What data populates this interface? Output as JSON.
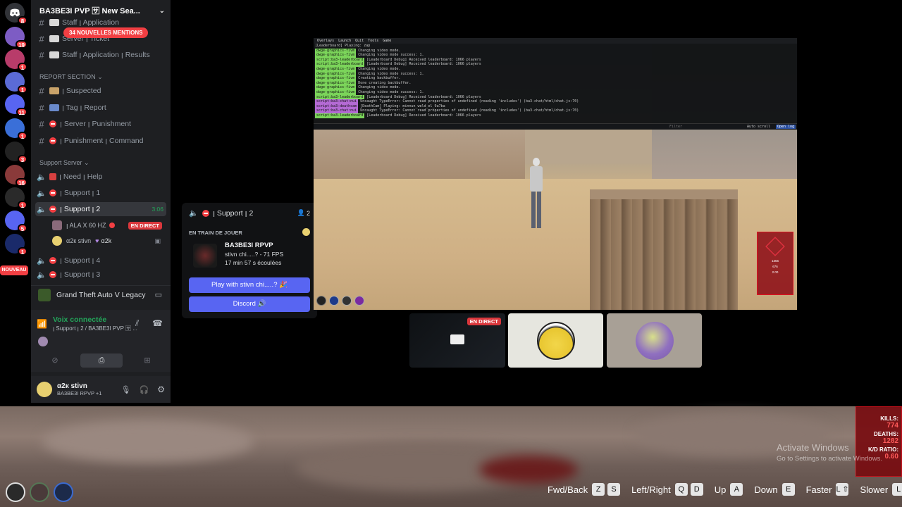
{
  "server": {
    "name": "BA3BE3I PVP 🈂 New Sea...",
    "mentions_badge": "34 NOUVELLES MENTIONS"
  },
  "rail": {
    "badges": [
      "8",
      "19",
      "1",
      "1",
      "11",
      "1",
      "3",
      "16",
      "1",
      "5",
      "1"
    ],
    "new_label": "NOUVEAU"
  },
  "channels": {
    "top": [
      {
        "label": "Staff ꞁ Application"
      },
      {
        "label": "Server ꞁ Ticket"
      },
      {
        "label": "Staff ꞁ Application ꞁ Results"
      }
    ],
    "report_category": "REPORT SECTION",
    "report": [
      {
        "label": "ꞁ Suspected"
      },
      {
        "label": "ꞁ Tag ꞁ Report"
      },
      {
        "label": "ꞁ Server ꞁ Punishment"
      },
      {
        "label": "ꞁ Punishment ꞁ Command"
      }
    ],
    "support_category": "Support Server",
    "support": [
      {
        "label": "ꞁ Need ꞁ Help"
      },
      {
        "label": "ꞁ Support ꞁ 1"
      },
      {
        "label": "ꞁ Support ꞁ 2",
        "time": "3:06"
      },
      {
        "label": "ꞁ Support ꞁ 4"
      },
      {
        "label": "ꞁ Support ꞁ 3"
      }
    ],
    "voice_users": [
      {
        "name": "ꞁ ALA X 60 HZ",
        "badge": "EN DIRECT"
      },
      {
        "name": "α2к stivn",
        "tag": "α2k"
      }
    ]
  },
  "game_activity": {
    "label": "Grand Theft Auto V Legacy"
  },
  "voice": {
    "status": "Voix connectée",
    "channel": "ꞁ Support ꞁ 2 / BA3BE3I PVP 🈂 ..."
  },
  "user": {
    "name": "α2к stivn",
    "status": "BA3BE3I RPVP +1"
  },
  "card": {
    "channel": "ꞁ Support ꞁ 2",
    "count": "2",
    "heading": "EN TRAIN DE JOUER",
    "game": "BA3BE3I RPVP",
    "detail": "stivn chi.....? - 71 FPS",
    "elapsed": "17 min 57 s écoulées",
    "play_button": "Play with stivn chi.....? 🎉",
    "discord_button": "Discord 🔊"
  },
  "console": {
    "menu": [
      "Overlays",
      "Launch",
      "Quit",
      "Tools",
      "Game"
    ],
    "lines": [
      {
        "tag": "",
        "text": "  [Leaderboard] Playing:   zap"
      },
      {
        "tag": "dwge-graphics-fivm",
        "type": "g",
        "text": "Changing video mode."
      },
      {
        "tag": "dwge-graphics-fivm",
        "type": "g",
        "text": "Changing video mode success: 1."
      },
      {
        "tag": "script:ba3-leaderboard",
        "type": "g",
        "text": "[Leaderboard Debug] Received leaderboard: 1066 players"
      },
      {
        "tag": "script:ba3-leaderboard",
        "type": "g",
        "text": "[Leaderboard Debug] Received leaderboard: 1066 players"
      },
      {
        "tag": "dwge-graphics-fivm",
        "type": "g",
        "text": "Changing video mode."
      },
      {
        "tag": "dwge-graphics-fivm",
        "type": "g",
        "text": "Changing video mode success: 1."
      },
      {
        "tag": "dwge-graphics-fivm",
        "type": "g",
        "text": "Creating backbuffer."
      },
      {
        "tag": "dwge-graphics-fivm",
        "type": "g",
        "text": "Done creating backbuffer."
      },
      {
        "tag": "dwge-graphics-fivm",
        "type": "g",
        "text": "Changing video mode."
      },
      {
        "tag": "dwge-graphics-fivm",
        "type": "g",
        "text": "Changing video mode success: 1."
      },
      {
        "tag": "script:ba3-leaderboard",
        "type": "g",
        "text": "[Leaderboard Debug] Received leaderboard: 1066 players"
      },
      {
        "tag": "script:ba3-chat:nui",
        "type": "p",
        "text": "Uncaught TypeError: Cannot read properties of undefined (reading 'includes') (ba3-chat/html/chat.js:70)"
      },
      {
        "tag": "script:ba3-deathcam",
        "type": "p",
        "text": "[DeathCam] Playing:   minnun_weld_el_9a7ba"
      },
      {
        "tag": "script:ba3-chat:nui",
        "type": "p",
        "text": "Uncaught TypeError: Cannot read properties of undefined (reading 'includes') (ba3-chat/html/chat.js:70)"
      },
      {
        "tag": "script:ba3-leaderboard",
        "type": "g",
        "text": "[Leaderboard Debug] Received leaderboard: 1066 players"
      }
    ],
    "filter_placeholder": "Filter",
    "auto_scroll": "Auto scroll",
    "open_log": "Open log"
  },
  "hud": {
    "kills": "1356",
    "deaths": "676",
    "ratio": "2.00"
  },
  "tiles": {
    "live_badge": "EN DIRECT"
  },
  "stats": {
    "kills_label": "KILLS:",
    "kills": "774",
    "deaths_label": "DEATHS:",
    "deaths": "1282",
    "ratio_label": "K/D RATIO:",
    "ratio": "0.60"
  },
  "watermark": {
    "title": "Activate Windows",
    "sub": "Go to Settings to activate Windows."
  },
  "controls": [
    {
      "label": "Fwd/Back",
      "keys": [
        "Z",
        "S"
      ]
    },
    {
      "label": "Left/Right",
      "keys": [
        "Q",
        "D"
      ]
    },
    {
      "label": "Up",
      "keys": [
        "A"
      ]
    },
    {
      "label": "Down",
      "keys": [
        "E"
      ]
    },
    {
      "label": "Faster",
      "keys": [
        "L ⇧"
      ]
    },
    {
      "label": "Slower",
      "keys": [
        "L"
      ]
    }
  ],
  "colors": {
    "discord_blurple": "#5865f2",
    "live_red": "#da373c",
    "voice_green": "#23a55a"
  }
}
